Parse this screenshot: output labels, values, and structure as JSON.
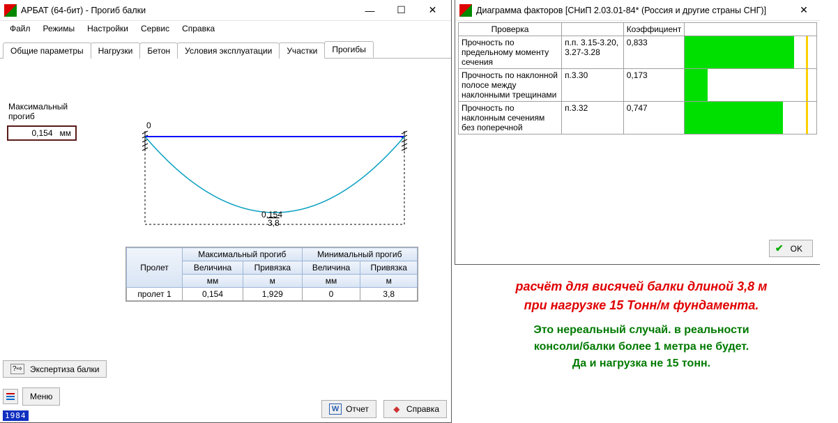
{
  "left": {
    "title": "АРБАТ (64-бит) - Прогиб балки",
    "menu": [
      "Файл",
      "Режимы",
      "Настройки",
      "Сервис",
      "Справка"
    ],
    "tabs": [
      "Общие параметры",
      "Нагрузки",
      "Бетон",
      "Условия эксплуатации",
      "Участки",
      "Прогибы"
    ],
    "active_tab": 5,
    "max_label1": "Максимальный",
    "max_label2": "прогиб",
    "max_value": "0,154",
    "max_unit": "мм",
    "chart_top_label": "0",
    "chart_mid_value": "0,154",
    "chart_span": "3,8",
    "table": {
      "span_header": "Пролет",
      "max_header": "Максимальный прогиб",
      "min_header": "Минимальный прогиб",
      "col_val": "Величина",
      "col_bind": "Привязка",
      "unit_mm": "мм",
      "unit_m": "м",
      "row_label": "пролет 1",
      "cells": [
        "0,154",
        "1,929",
        "0",
        "3,8"
      ]
    },
    "expertise_label": "Экспертиза балки",
    "menu_btn": "Меню",
    "report_btn": "Отчет",
    "help_btn": "Справка",
    "badge": "1984"
  },
  "right": {
    "title": "Диаграмма факторов [СНиП 2.03.01-84* (Россия и другие страны СНГ)]",
    "col_check": "Проверка",
    "col_coef": "Коэффициент",
    "rows": [
      {
        "check": "Прочность по предельному моменту сечения",
        "ref": "п.п. 3.15-3.20, 3.27-3.28",
        "coef": "0,833",
        "bar": 0.833
      },
      {
        "check": "Прочность по наклонной полосе между наклонными трещинами",
        "ref": "п.3.30",
        "coef": "0,173",
        "bar": 0.173
      },
      {
        "check": "Прочность по наклонным сечениям без поперечной",
        "ref": "п.3.32",
        "coef": "0,747",
        "bar": 0.747
      }
    ],
    "ok": "OK"
  },
  "annotation": {
    "red1": "расчёт для висячей балки длиной 3,8 м",
    "red2": "при нагрузке 15 Тонн/м фундамента.",
    "green1": "Это нереальный случай. в реальности",
    "green2": "консоли/балки  более 1 метра не будет.",
    "green3": "Да и нагрузка не 15 тонн."
  },
  "chart_data": {
    "type": "line",
    "title": "Прогиб балки",
    "xlabel": "м",
    "ylabel": "мм",
    "x_range": [
      0,
      3.8
    ],
    "y_range": [
      0,
      0.154
    ],
    "series": [
      {
        "name": "прогиб",
        "x": [
          0,
          1.929,
          3.8
        ],
        "y": [
          0,
          0.154,
          0
        ]
      }
    ],
    "max_value": 0.154,
    "max_position": 1.929,
    "span_length": 3.8
  }
}
